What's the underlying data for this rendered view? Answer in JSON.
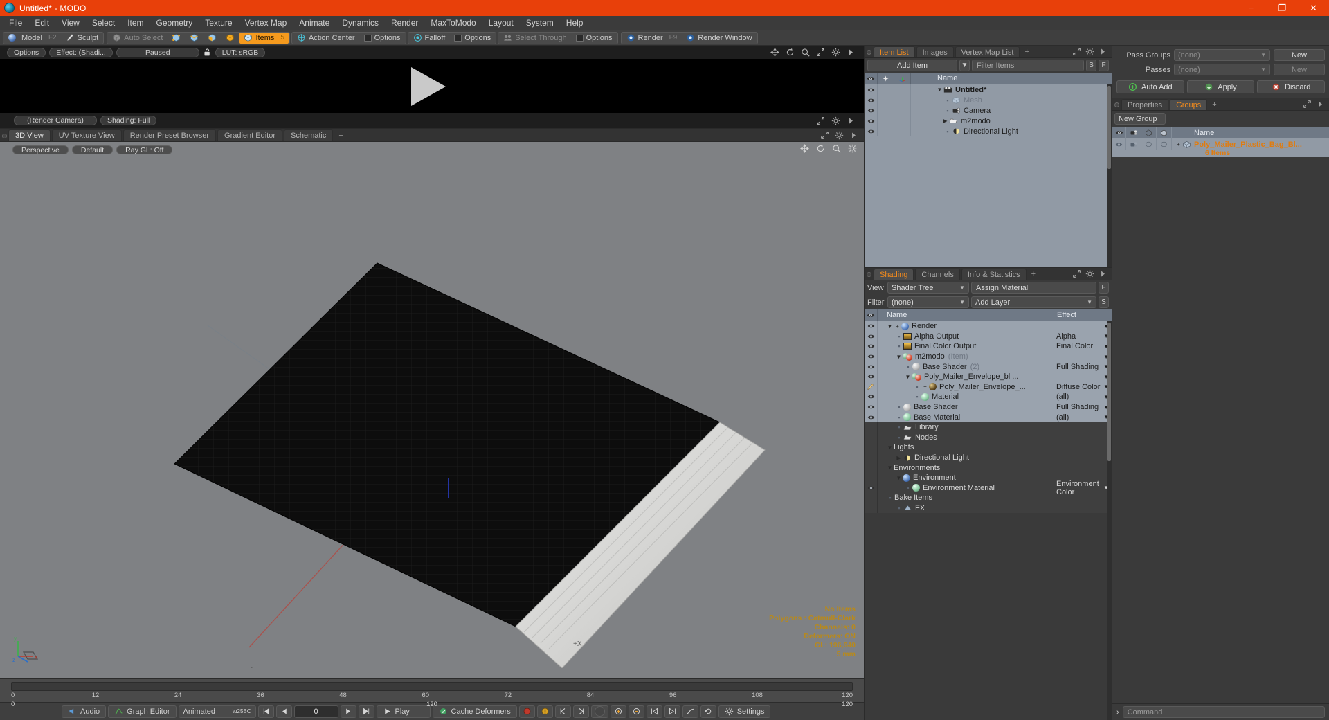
{
  "window": {
    "title": "Untitled* - MODO",
    "logo_icon": "modo-logo-icon",
    "minimize": "−",
    "maximize": "❐",
    "close": "✕",
    "accent_color": "#e8400a"
  },
  "menubar": {
    "items": [
      "File",
      "Edit",
      "View",
      "Select",
      "Item",
      "Geometry",
      "Texture",
      "Vertex Map",
      "Animate",
      "Dynamics",
      "Render",
      "MaxToModo",
      "Layout",
      "System",
      "Help"
    ]
  },
  "toolbar": {
    "mode_group": [
      {
        "label": "Model",
        "shortcut": "F2",
        "icon": "sphere-icon",
        "active": false
      },
      {
        "label": "Sculpt",
        "shortcut": "",
        "icon": "brush-icon",
        "active": false
      }
    ],
    "select_group": [
      {
        "label": "Auto Select",
        "icon": "cube-icon",
        "active": false,
        "dim": true
      },
      {
        "label": "",
        "icon": "vertex-select-icon",
        "active": false
      },
      {
        "label": "",
        "icon": "edge-select-icon",
        "active": false
      },
      {
        "label": "",
        "icon": "polygon-select-icon",
        "active": false
      },
      {
        "label": "",
        "icon": "material-select-icon",
        "active": false
      },
      {
        "label": "Items",
        "shortcut": "5",
        "icon": "item-select-icon",
        "active": true
      }
    ],
    "action_group": [
      {
        "label": "Action Center",
        "icon": "action-center-icon"
      },
      {
        "label": "Options",
        "icon": "panel-icon"
      }
    ],
    "falloff_group": [
      {
        "label": "Falloff",
        "icon": "falloff-icon"
      },
      {
        "label": "Options",
        "icon": "panel-icon"
      }
    ],
    "through_group": [
      {
        "label": "Select Through",
        "icon": "select-through-icon",
        "dim": true
      },
      {
        "label": "Options",
        "icon": "panel-icon"
      }
    ],
    "render_group": [
      {
        "label": "Render",
        "shortcut": "F9",
        "icon": "render-icon"
      },
      {
        "label": "Render Window",
        "icon": "render-window-icon"
      }
    ]
  },
  "render_preview": {
    "options_label": "Options",
    "effect_label": "Effect: (Shadi...",
    "state_label": "Paused",
    "lock_icon": "unlock-icon",
    "lut_label": "LUT: sRGB",
    "camera_label": "(Render Camera)",
    "shading_label": "Shading: Full",
    "play_icon": "play-triangle-icon",
    "gadgets": [
      "move-icon",
      "rotate-icon",
      "zoom-icon",
      "fit-icon",
      "gear-icon",
      "chevron-right-icon"
    ],
    "gadgets2": [
      "fit-icon",
      "gear-icon",
      "chevron-right-icon"
    ]
  },
  "viewport_tabs": {
    "tabs": [
      {
        "label": "3D View",
        "active": true
      },
      {
        "label": "UV Texture View",
        "active": false
      },
      {
        "label": "Render Preset Browser",
        "active": false
      },
      {
        "label": "Gradient Editor",
        "active": false
      },
      {
        "label": "Schematic",
        "active": false
      }
    ],
    "add_label": "+",
    "right_gadgets": [
      "fit-icon",
      "gear-icon",
      "chevron-right-icon"
    ]
  },
  "viewport": {
    "perspective_label": "Perspective",
    "default_label": "Default",
    "raygl_label": "Ray GL: Off",
    "head_gadgets": [
      "move-icon",
      "rotate-icon",
      "zoom-icon",
      "gear-icon"
    ],
    "axis_x_label": "+X",
    "axis_z_label": "-Z",
    "stats": [
      {
        "text": "No Items",
        "highlight": true
      },
      {
        "text": "Polygons : Catmull-Clark",
        "highlight": true
      },
      {
        "text": "Channels: 0",
        "highlight": true
      },
      {
        "text": "Deformers: ON",
        "highlight": true
      },
      {
        "text": "GL: 196,640",
        "highlight": true
      },
      {
        "text": "5 mm",
        "highlight": true
      }
    ],
    "gizmo_labels": [
      "y",
      "x",
      "z"
    ]
  },
  "timeline": {
    "ticks": [
      "0",
      "12",
      "24",
      "36",
      "48",
      "60",
      "72",
      "84",
      "96",
      "108",
      "120"
    ],
    "range_start": "0",
    "range_mid": "120",
    "range_end": "120"
  },
  "bottombar": {
    "audio": "Audio",
    "graph_editor": "Graph Editor",
    "animated": "Animated",
    "frame_value": "0",
    "play": "Play",
    "cache_deformers": "Cache Deformers",
    "settings": "Settings",
    "transport_icons": [
      "skip-start-icon",
      "step-back-icon",
      "step-forward-icon",
      "skip-end-icon"
    ],
    "right_icons": [
      "record-icon",
      "warning-icon",
      "key-prev-icon",
      "key-next-icon",
      "key-set-icon",
      "key-add-icon",
      "key-remove-icon",
      "range-start-icon",
      "range-end-icon",
      "curve-icon",
      "undo-icon",
      "gear-icon"
    ]
  },
  "item_list": {
    "tabs": [
      {
        "label": "Item List",
        "active": true
      },
      {
        "label": "Images",
        "active": false
      },
      {
        "label": "Vertex Map List",
        "active": false
      }
    ],
    "add_label": "+",
    "add_item_button": "Add Item",
    "filter_placeholder": "Filter Items",
    "filter_s": "S",
    "filter_f": "F",
    "columns": [
      "eye-icon",
      "lock-icon",
      "axis-icon",
      "Name"
    ],
    "rows": [
      {
        "name": "Untitled*",
        "icon": "scene-icon",
        "depth": 0,
        "bold": true,
        "disclosure": "down",
        "dim": false
      },
      {
        "name": "Mesh",
        "icon": "mesh-icon",
        "depth": 1,
        "bold": false,
        "disclosure": "",
        "dim": true
      },
      {
        "name": "Camera",
        "icon": "camera-icon",
        "depth": 1,
        "bold": false,
        "disclosure": "",
        "dim": false
      },
      {
        "name": "m2modo",
        "icon": "group-icon",
        "depth": 1,
        "bold": false,
        "disclosure": "right",
        "dim": false
      },
      {
        "name": "Directional Light",
        "icon": "light-icon",
        "depth": 1,
        "bold": false,
        "disclosure": "",
        "dim": false
      }
    ]
  },
  "shading_panel": {
    "tabs": [
      {
        "label": "Shading",
        "active": true
      },
      {
        "label": "Channels",
        "active": false
      },
      {
        "label": "Info & Statistics",
        "active": false
      }
    ],
    "add_label": "+",
    "view_label": "View",
    "view_value": "Shader Tree",
    "assign_material": "Assign Material",
    "assign_f": "F",
    "filter_label": "Filter",
    "filter_value": "(none)",
    "add_layer": "Add Layer",
    "add_layer_s": "S",
    "col_name": "Name",
    "col_effect": "Effect",
    "rows": [
      {
        "name": "Render",
        "effect": "",
        "depth": 0,
        "icon": "sphere-blue",
        "disclosure": "down",
        "plus": true,
        "eye": true,
        "bg": true
      },
      {
        "name": "Alpha Output",
        "effect": "Alpha",
        "depth": 1,
        "icon": "image-output",
        "disclosure": "",
        "eye": true,
        "bg": true
      },
      {
        "name": "Final Color Output",
        "effect": "Final Color",
        "depth": 1,
        "icon": "image-output",
        "disclosure": "",
        "eye": true,
        "bg": true
      },
      {
        "name": "m2modo",
        "suffix": "(Item)",
        "effect": "",
        "depth": 1,
        "icon": "material-group",
        "disclosure": "down",
        "eye": true,
        "bg": true
      },
      {
        "name": "Base Shader",
        "suffix": "(2)",
        "effect": "Full Shading",
        "depth": 2,
        "icon": "sphere-grey",
        "disclosure": "",
        "eye": true,
        "bg": true
      },
      {
        "name": "Poly_Mailer_Envelope_bl  ...",
        "effect": "",
        "depth": 2,
        "icon": "material-group",
        "disclosure": "down",
        "eye": true,
        "bg": true
      },
      {
        "name": "Poly_Mailer_Envelope_...",
        "effect": "Diffuse Color",
        "depth": 3,
        "icon": "sphere-dark",
        "disclosure": "",
        "plus": true,
        "eye": false,
        "brush": true,
        "bg": true
      },
      {
        "name": "Material",
        "effect": "(all)",
        "depth": 3,
        "icon": "sphere-green",
        "disclosure": "",
        "eye": true,
        "bg": true
      },
      {
        "name": "Base Shader",
        "effect": "Full Shading",
        "depth": 1,
        "icon": "sphere-grey",
        "disclosure": "",
        "eye": true,
        "bg": true
      },
      {
        "name": "Base Material",
        "effect": "(all)",
        "depth": 1,
        "icon": "sphere-green",
        "disclosure": "",
        "eye": true,
        "bg": true
      },
      {
        "name": "Library",
        "effect": "",
        "depth": 1,
        "icon": "folder-icon",
        "disclosure": "",
        "eye": false,
        "bg": false
      },
      {
        "name": "Nodes",
        "effect": "",
        "depth": 1,
        "icon": "folder-icon",
        "disclosure": "",
        "eye": false,
        "bg": false
      },
      {
        "name": "Lights",
        "effect": "",
        "depth": 0,
        "icon": "",
        "disclosure": "down",
        "eye": false,
        "bg": false
      },
      {
        "name": "Directional Light",
        "effect": "",
        "depth": 1,
        "icon": "light-icon",
        "disclosure": "right",
        "eye": false,
        "bg": false
      },
      {
        "name": "Environments",
        "effect": "",
        "depth": 0,
        "icon": "",
        "disclosure": "down",
        "eye": false,
        "bg": false
      },
      {
        "name": "Environment",
        "effect": "",
        "depth": 1,
        "icon": "sphere-blue",
        "disclosure": "down",
        "eye": false,
        "bg": false
      },
      {
        "name": "Environment Material",
        "effect": "Environment Color",
        "depth": 2,
        "icon": "sphere-green",
        "disclosure": "",
        "eye": true,
        "bg": false
      },
      {
        "name": "Bake Items",
        "effect": "",
        "depth": 0,
        "icon": "",
        "disclosure": "",
        "eye": false,
        "bg": false
      },
      {
        "name": "FX",
        "effect": "",
        "depth": 1,
        "icon": "fx-icon",
        "disclosure": "",
        "eye": false,
        "bg": false
      }
    ]
  },
  "passes_panel": {
    "pass_groups_label": "Pass Groups",
    "pass_groups_value": "(none)",
    "pass_groups_new": "New",
    "passes_label": "Passes",
    "passes_value": "(none)",
    "passes_new": "New",
    "auto_add": "Auto Add",
    "apply": "Apply",
    "discard": "Discard"
  },
  "groups_panel": {
    "tabs": [
      {
        "label": "Properties",
        "active": false
      },
      {
        "label": "Groups",
        "active": true
      }
    ],
    "add_label": "+",
    "new_group_button": "New Group",
    "columns": [
      "eye-icon",
      "camera-icon",
      "render-icon",
      "shade-icon",
      "Name"
    ],
    "rows": [
      {
        "name": "Poly_Mailer_Plastic_Bag_Bl...",
        "sub": "6 Items",
        "icon": "group-mesh-icon"
      }
    ]
  },
  "command_bar": {
    "prompt": "›",
    "placeholder": "Command"
  }
}
